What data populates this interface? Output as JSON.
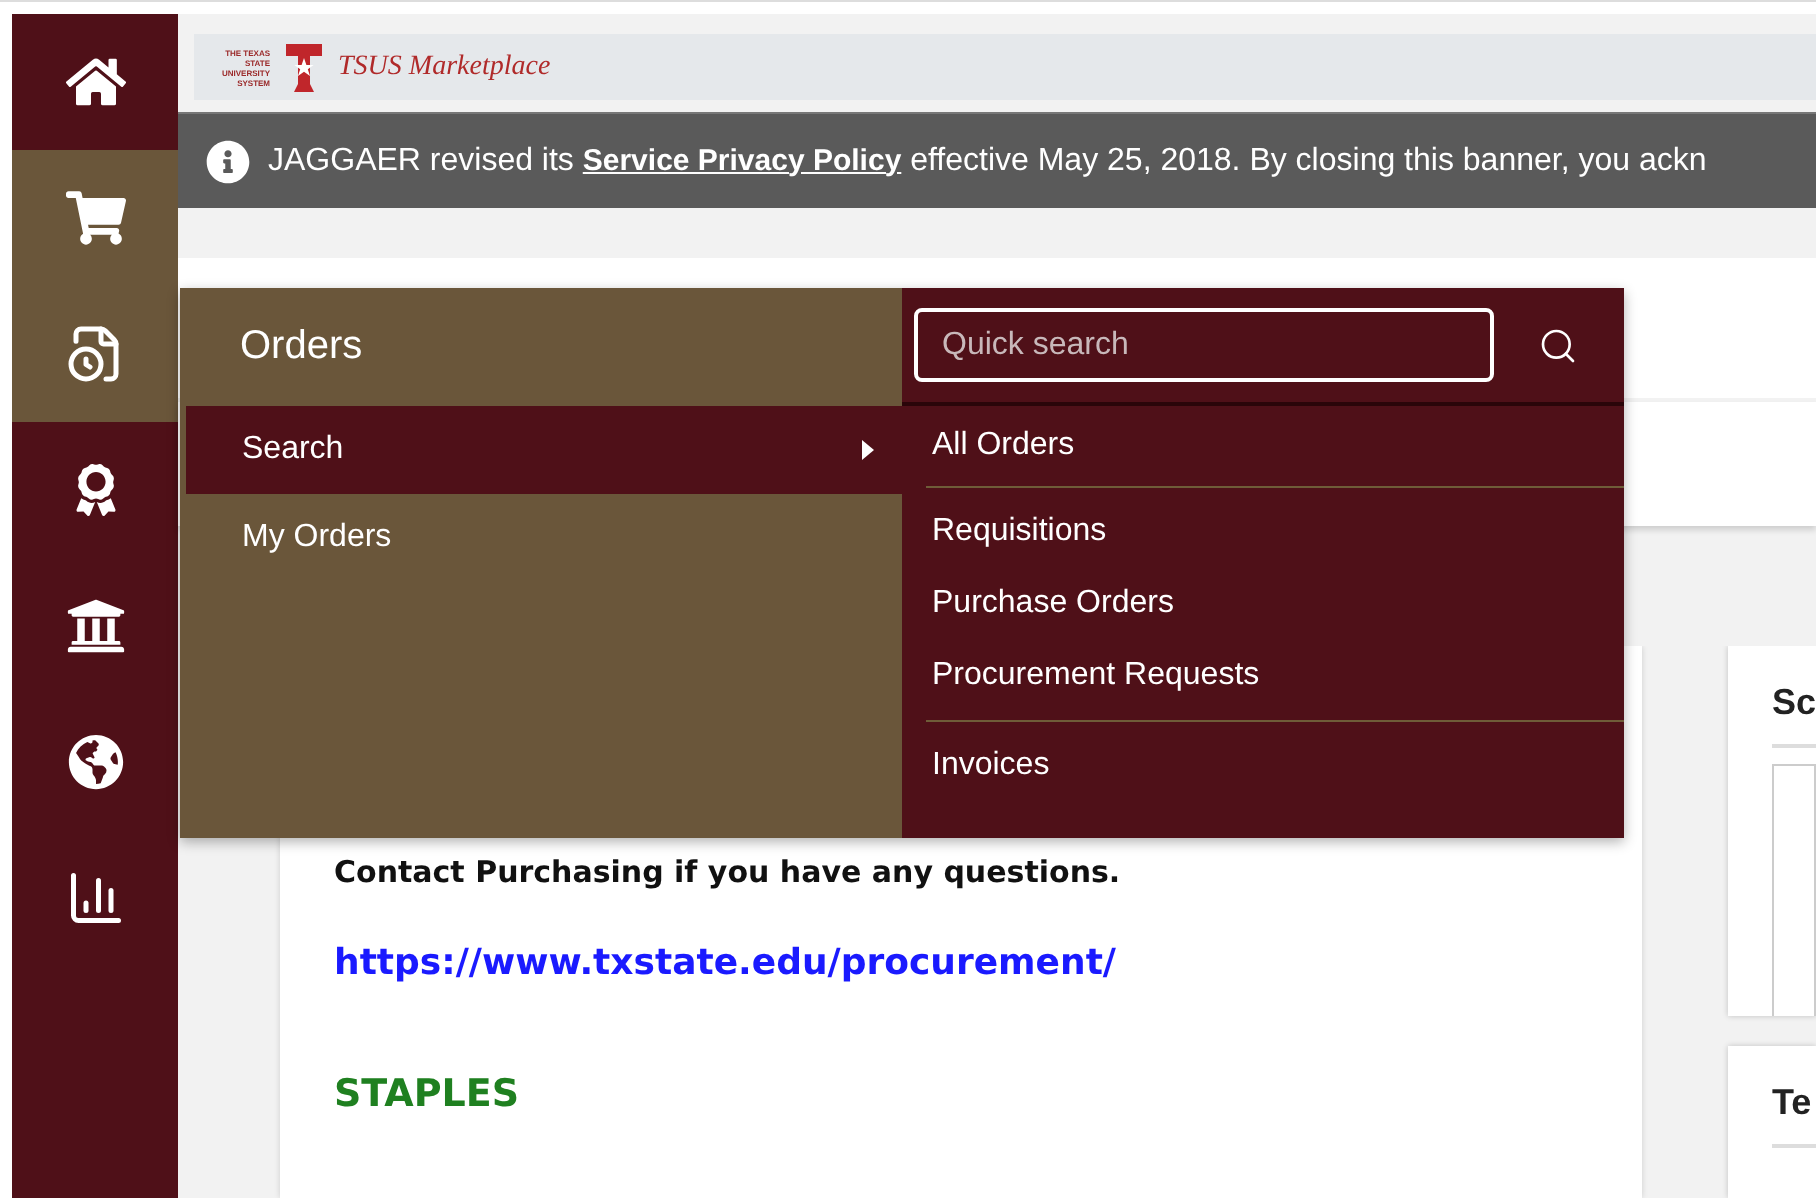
{
  "sidebar": {
    "items": [
      {
        "kind": "home",
        "active": false
      },
      {
        "kind": "cart",
        "active": true
      },
      {
        "kind": "orders",
        "active": true
      },
      {
        "kind": "award",
        "active": false
      },
      {
        "kind": "bank",
        "active": false
      },
      {
        "kind": "globe",
        "active": false
      },
      {
        "kind": "chart",
        "active": false
      }
    ]
  },
  "header": {
    "logo_lines": [
      "THE TEXAS",
      "STATE",
      "UNIVERSITY",
      "SYSTEM"
    ],
    "site_name": "TSUS Marketplace"
  },
  "banner": {
    "text": "JAGGAER revised its **Service Privacy Policy** effective May 25, 2018. By closing this banner, you ackn"
  },
  "flyout": {
    "title": "Orders",
    "items": [
      {
        "label": "Search",
        "selected": true,
        "has_submenu": true
      },
      {
        "label": "My Orders",
        "selected": false,
        "has_submenu": false
      }
    ],
    "search": {
      "placeholder": "Quick search"
    },
    "groups": [
      [
        "All Orders"
      ],
      [
        "Requisitions",
        "Purchase Orders",
        "Procurement Requests"
      ],
      [
        "Invoices"
      ]
    ]
  },
  "content": {
    "notice": "Contact Purchasing if you have any questions.",
    "link": "https://www.txstate.edu/procurement/",
    "heading": "STAPLES"
  },
  "side_cards": [
    {
      "title": "Sc"
    },
    {
      "title": "Te"
    }
  ]
}
